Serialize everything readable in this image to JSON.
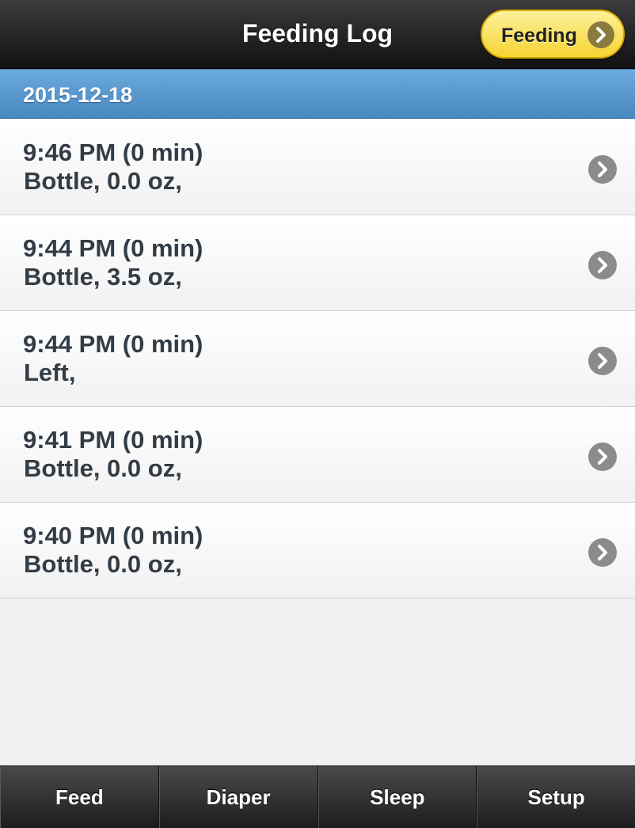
{
  "header": {
    "title": "Feeding Log",
    "feeding_button_label": "Feeding",
    "feeding_button_icon": "chevron-right-icon"
  },
  "date_divider": "2015-12-18",
  "entries": [
    {
      "time": "9:46 PM (0 min)",
      "detail": "Bottle, 0.0 oz,"
    },
    {
      "time": "9:44 PM (0 min)",
      "detail": "Bottle, 3.5 oz,"
    },
    {
      "time": "9:44 PM (0 min)",
      "detail": "Left,"
    },
    {
      "time": "9:41 PM (0 min)",
      "detail": "Bottle, 0.0 oz,"
    },
    {
      "time": "9:40 PM (0 min)",
      "detail": "Bottle, 0.0 oz,"
    }
  ],
  "tabs": [
    {
      "label": "Feed"
    },
    {
      "label": "Diaper"
    },
    {
      "label": "Sleep"
    },
    {
      "label": "Setup"
    }
  ],
  "colors": {
    "header_bg": "#1f1f1f",
    "feeding_button": "#f8df55",
    "date_divider_bg": "#5b9bd0",
    "text": "#333c45"
  }
}
